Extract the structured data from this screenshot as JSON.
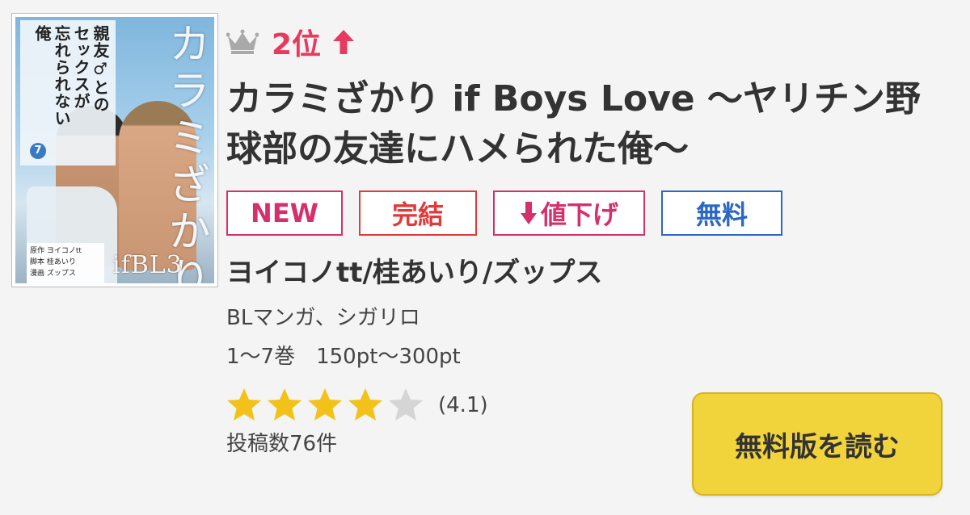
{
  "cover": {
    "subtitle_lines": [
      "俺",
      "忘れられない",
      "セックスが",
      "親友♂との"
    ],
    "volume": "7",
    "series": "カラミざかり",
    "credits": [
      "原作 ヨイコノtt",
      "脚本 桂あいり",
      "漫画 ズップス"
    ],
    "logo": "ifBL3"
  },
  "rank": {
    "label": "2位",
    "trend": "up",
    "color": "#e8395e"
  },
  "title": "カラミざかり if Boys Love 〜ヤリチン野球部の友達にハメられた俺〜",
  "tags": {
    "new": "NEW",
    "complete": "完結",
    "price_down": "値下げ",
    "free": "無料"
  },
  "author": "ヨイコノtt/桂あいり/ズップス",
  "genre": "BLマンガ、シガリロ",
  "volumes_price": "1〜7巻　150pt〜300pt",
  "rating": {
    "value": 4.1,
    "label": "(4.1)",
    "max": 5
  },
  "reviews": "投稿数76件",
  "read_button": "無料版を読む",
  "colors": {
    "accent_pink": "#d6306c",
    "accent_red": "#e2393a",
    "accent_blue": "#2b68c6",
    "button_yellow": "#f1d33c",
    "star_gold": "#f2c21b"
  }
}
